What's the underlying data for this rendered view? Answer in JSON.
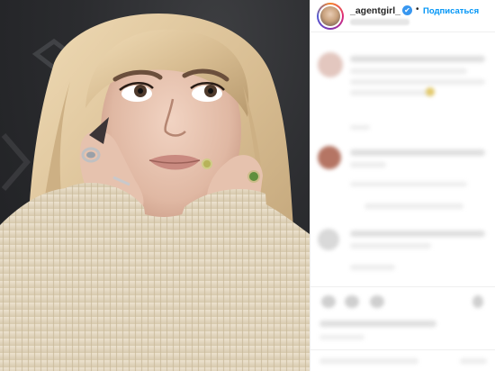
{
  "post": {
    "username": "_agentgirl_",
    "verified_symbol": "✔",
    "separator": "•",
    "follow_label": "Подписаться"
  },
  "colors": {
    "follow_blue": "#0095f6",
    "verified_blue": "#3897f0",
    "photo_background": "#2b2c2f"
  },
  "icons": {
    "verified": "verified-badge-icon",
    "avatar": "profile-avatar"
  }
}
